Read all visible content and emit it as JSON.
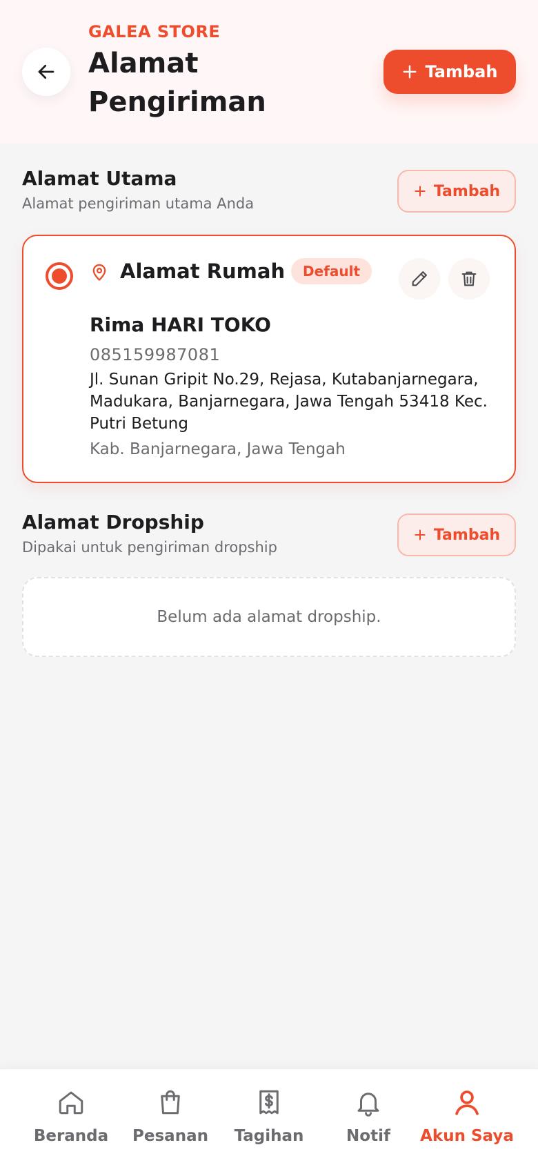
{
  "colors": {
    "accent": "#ee4d2d",
    "muted": "#6b6b70",
    "text": "#1d1d1f"
  },
  "header": {
    "store_name": "GALEA STORE",
    "title": "Alamat Pengiriman",
    "add_label": "Tambah",
    "back_icon": "arrow-left-icon"
  },
  "primary_section": {
    "title": "Alamat Utama",
    "subtitle": "Alamat pengiriman utama Anda",
    "add_label": "Tambah"
  },
  "address": {
    "selected": true,
    "label": "Alamat Rumah",
    "badge": "Default",
    "recipient": "Rima HARI TOKO",
    "phone": "085159987081",
    "street": "Jl. Sunan Gripit No.29, Rejasa, Kutabanjarnegara, Madukara, Banjarnegara, Jawa Tengah 53418 Kec. Putri Betung",
    "region": "Kab. Banjarnegara, Jawa Tengah"
  },
  "dropship_section": {
    "title": "Alamat Dropship",
    "subtitle": "Dipakai untuk pengiriman dropship",
    "add_label": "Tambah",
    "empty_text": "Belum ada alamat dropship."
  },
  "bottom_nav": {
    "active": "Akun Saya",
    "items": [
      {
        "label": "Beranda",
        "icon": "home-icon"
      },
      {
        "label": "Pesanan",
        "icon": "shopping-bag-icon"
      },
      {
        "label": "Tagihan",
        "icon": "receipt-icon"
      },
      {
        "label": "Notif",
        "icon": "bell-icon"
      },
      {
        "label": "Akun Saya",
        "icon": "user-icon"
      }
    ]
  }
}
